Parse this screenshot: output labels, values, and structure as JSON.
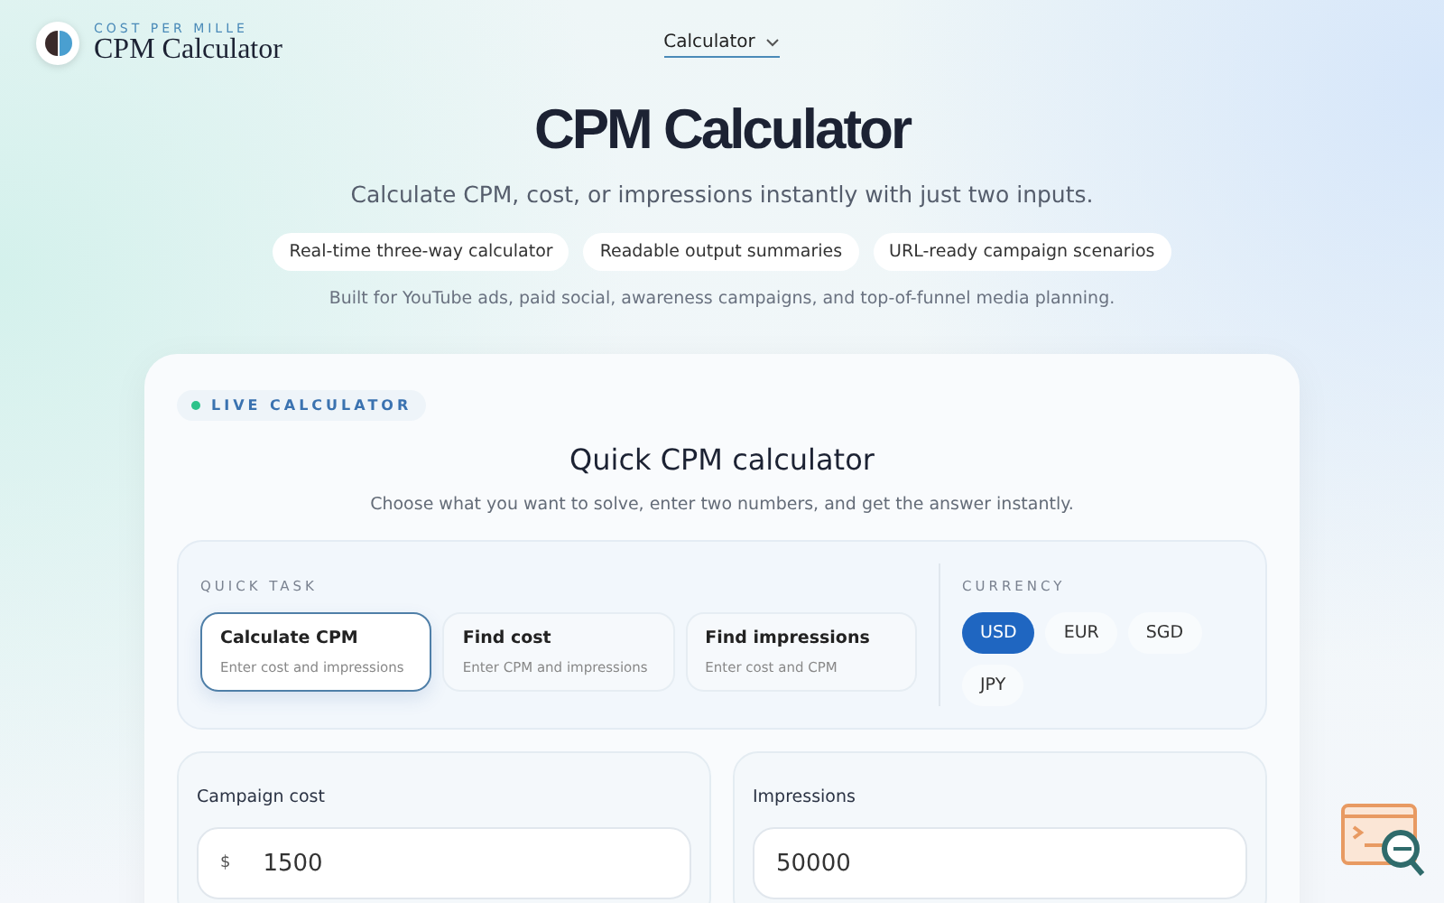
{
  "brand": {
    "eyebrow": "COST PER MILLE",
    "name": "CPM Calculator"
  },
  "nav": {
    "label": "Calculator",
    "selected": true
  },
  "hero": {
    "title": "CPM Calculator",
    "subtitle": "Calculate CPM, cost, or impressions instantly with just two inputs.",
    "chips": [
      "Real-time three-way calculator",
      "Readable output summaries",
      "URL-ready campaign scenarios"
    ],
    "note": "Built for YouTube ads, paid social, awareness campaigns, and top-of-funnel media planning."
  },
  "card": {
    "badge": "LIVE CALCULATOR",
    "title": "Quick CPM calculator",
    "description": "Choose what you want to solve, enter two numbers, and get the answer instantly.",
    "task_label": "QUICK TASK",
    "tasks": [
      {
        "title": "Calculate CPM",
        "hint": "Enter cost and impressions",
        "selected": true
      },
      {
        "title": "Find cost",
        "hint": "Enter CPM and impressions",
        "selected": false
      },
      {
        "title": "Find impressions",
        "hint": "Enter cost and CPM",
        "selected": false
      }
    ],
    "currency_label": "CURRENCY",
    "currencies": [
      {
        "code": "USD",
        "selected": true
      },
      {
        "code": "EUR",
        "selected": false
      },
      {
        "code": "SGD",
        "selected": false
      },
      {
        "code": "JPY",
        "selected": false
      }
    ],
    "inputs": [
      {
        "label": "Campaign cost",
        "prefix": "$",
        "value": "1500"
      },
      {
        "label": "Impressions",
        "value": "50000"
      }
    ]
  }
}
